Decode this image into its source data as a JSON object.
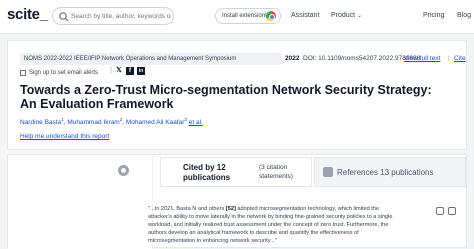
{
  "header": {
    "logo": "scite_",
    "search_placeholder": "Search by title, author, keywords or DOI",
    "install_label": "Install extension!",
    "nav": [
      {
        "label": "Assistant"
      },
      {
        "label": "Product",
        "has_dropdown": true
      },
      {
        "label": "Pricing"
      },
      {
        "label": "Blog"
      }
    ]
  },
  "paper": {
    "publication": "NOMS 2022-2022 IEEE/IFIP Network Operations and Management Symposium",
    "year": "2022",
    "doi": "DOI: 10.1109/noms54207.2022.9789888",
    "view_full_text": "View full text",
    "separator": "|",
    "cite": "Cite",
    "alert_label": "Sign up to set email alerts",
    "alert_separator": "|",
    "title": "Towards a Zero-Trust Micro-segmentation Network Security Strategy: An Evaluation Framework",
    "authors": [
      {
        "name": "Nardine Basta",
        "sup": "1"
      },
      {
        "name": "Muhammad Ikram",
        "sup": "2"
      },
      {
        "name": "Mohamed Ali Kaafar",
        "sup": "3"
      }
    ],
    "etal": "et al.",
    "help_link": "Help me understand this report"
  },
  "tabs": {
    "cited_main": "Cited by 12 publications",
    "cited_sub": "(3 citation statements)",
    "references": "References 13 publications"
  },
  "citation": {
    "lead": "\"...In 2021, Basta N and others ",
    "ref": "[52]",
    "body": " adopted microsegmentation technology, which limited the attacker's ability to move laterally in the network by binding fine-grained security policies to a single workload, and initially realized trust assessment under the concept of zero trust. Furthermore, the authors develop an analytical framework to describe and quantify the effectiveness of microsegmentation in enhancing network security...\""
  },
  "colors": {
    "link": "#1d4ed8",
    "text": "#1f2937",
    "background": "#f4f5f7"
  }
}
